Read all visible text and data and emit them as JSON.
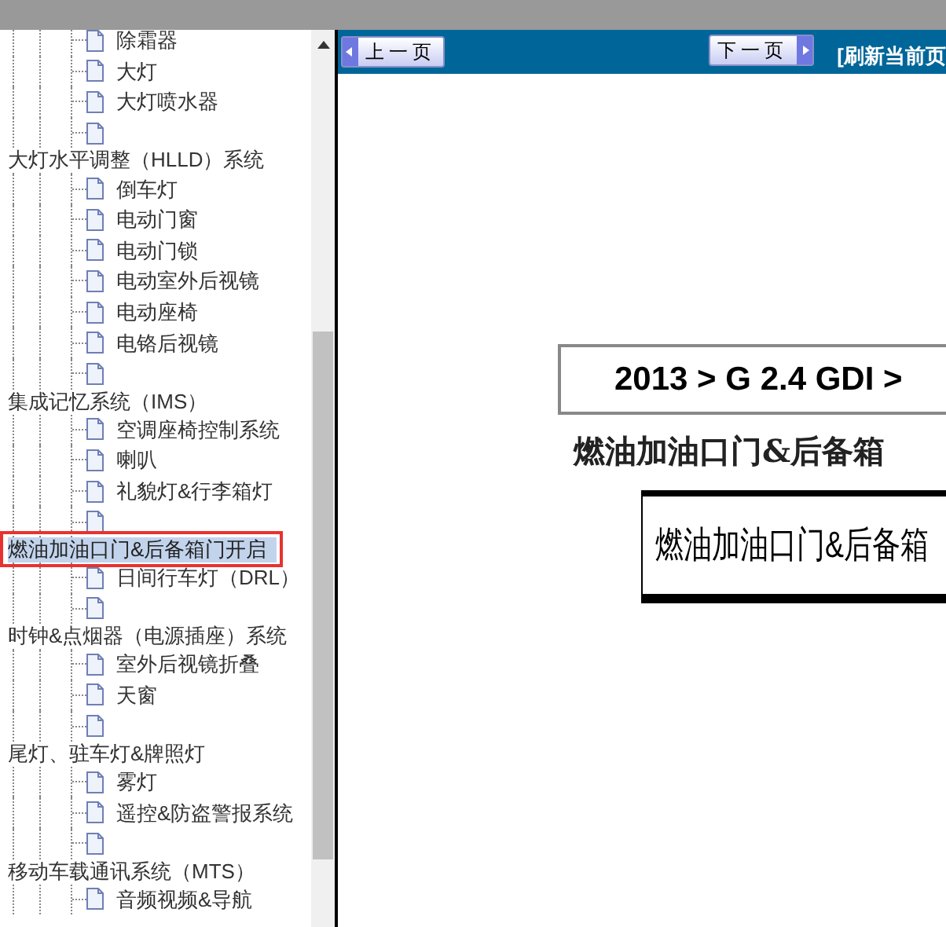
{
  "tree": [
    {
      "children": [
        {
          "label": "除霜器"
        },
        {
          "label": "大灯"
        },
        {
          "label": "大灯喷水器"
        }
      ],
      "blank_page": true
    },
    {
      "label": "大灯水平调整（HLLD）系统",
      "selected": false,
      "children": [
        {
          "label": "倒车灯"
        },
        {
          "label": "电动门窗"
        },
        {
          "label": "电动门锁"
        },
        {
          "label": "电动室外后视镜"
        },
        {
          "label": "电动座椅"
        },
        {
          "label": "电铬后视镜"
        }
      ],
      "blank_page": true
    },
    {
      "label": "集成记忆系统（IMS）",
      "selected": false,
      "children": [
        {
          "label": "空调座椅控制系统"
        },
        {
          "label": "喇叭"
        },
        {
          "label": "礼貌灯&行李箱灯"
        }
      ],
      "blank_page": true
    },
    {
      "label": "燃油加油口门&后备箱门开启",
      "selected": true,
      "children": [
        {
          "label": "日间行车灯（DRL）"
        }
      ],
      "blank_page": true
    },
    {
      "label": "时钟&点烟器（电源插座）系统",
      "selected": false,
      "children": [
        {
          "label": "室外后视镜折叠"
        },
        {
          "label": "天窗"
        }
      ],
      "blank_page": true
    },
    {
      "label": "尾灯、驻车灯&牌照灯",
      "selected": false,
      "children": [
        {
          "label": "雾灯"
        },
        {
          "label": "遥控&防盗警报系统"
        }
      ],
      "blank_page": true
    },
    {
      "label": "移动车载通讯系统（MTS）",
      "selected": false,
      "children": [
        {
          "label": "音频视频&导航"
        }
      ]
    }
  ],
  "toolbar": {
    "prev": "上一页",
    "next": "下一页",
    "refresh": "[刷新当前页"
  },
  "document": {
    "breadcrumb": "2013 > G 2.4 GDI >",
    "heading": "燃油加油口门&后备箱",
    "figure_title": "燃油加油口门&后备箱"
  }
}
